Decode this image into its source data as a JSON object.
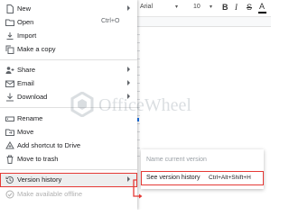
{
  "toolbar": {
    "font_name": "Arial",
    "font_size": "10",
    "bold": "B",
    "italic": "I",
    "strikethrough": "S",
    "text_color": "A"
  },
  "menu": {
    "items": [
      {
        "label": "New",
        "icon": "file-icon",
        "submenu": true
      },
      {
        "label": "Open",
        "icon": "folder-icon",
        "shortcut": "Ctrl+O"
      },
      {
        "label": "Import",
        "icon": "import-icon"
      },
      {
        "label": "Make a copy",
        "icon": "copy-icon"
      },
      {
        "label": "Share",
        "icon": "share-icon",
        "submenu": true
      },
      {
        "label": "Email",
        "icon": "email-icon",
        "submenu": true
      },
      {
        "label": "Download",
        "icon": "download-icon",
        "submenu": true
      },
      {
        "label": "Rename",
        "icon": "rename-icon"
      },
      {
        "label": "Move",
        "icon": "move-icon"
      },
      {
        "label": "Add shortcut to Drive",
        "icon": "drive-shortcut-icon"
      },
      {
        "label": "Move to trash",
        "icon": "trash-icon"
      },
      {
        "label": "Version history",
        "icon": "history-icon",
        "submenu": true
      },
      {
        "label": "Make available offline",
        "icon": "offline-icon",
        "disabled": true
      }
    ]
  },
  "submenu": {
    "items": [
      {
        "label": "Name current version",
        "disabled": true
      },
      {
        "label": "See version history",
        "shortcut": "Ctrl+Alt+Shift+H"
      }
    ]
  },
  "watermark": {
    "text": "OfficeWheel"
  },
  "colors": {
    "highlight": "#e53935",
    "menu_text": "#202124",
    "icon": "#5f6368",
    "disabled": "#b0b0b0"
  }
}
